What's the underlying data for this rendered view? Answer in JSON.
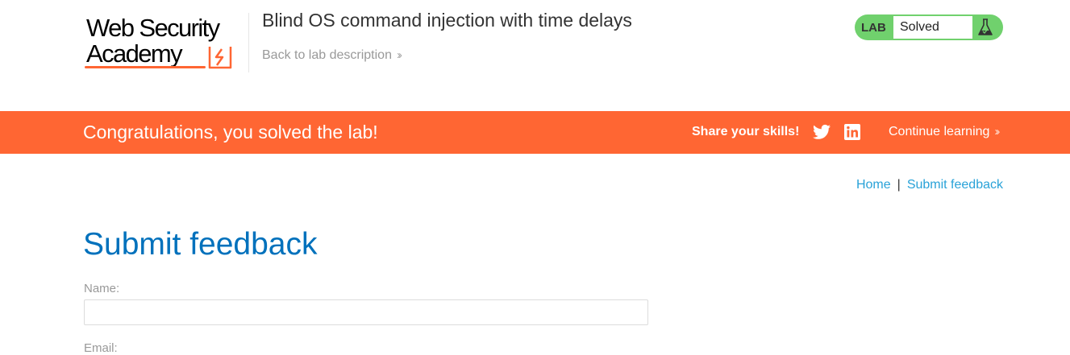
{
  "header": {
    "logo_line1": "Web Security",
    "logo_line2": "Academy",
    "lab_title": "Blind OS command injection with time delays",
    "back_link": "Back to lab description",
    "status_tag": "LAB",
    "status_value": "Solved",
    "status_icon": "flask-icon"
  },
  "banner": {
    "message": "Congratulations, you solved the lab!",
    "share_label": "Share your skills!",
    "share_icons": [
      "twitter-icon",
      "linkedin-icon"
    ],
    "continue_label": "Continue learning"
  },
  "breadcrumb": {
    "home": "Home",
    "separator": "|",
    "current": "Submit feedback"
  },
  "main": {
    "title": "Submit feedback",
    "name_label": "Name:",
    "name_value": "",
    "email_label": "Email:"
  },
  "colors": {
    "accent": "#ff6633",
    "status_green": "#70d16d",
    "title_blue": "#0071bc",
    "link_blue": "#29a2d8"
  }
}
